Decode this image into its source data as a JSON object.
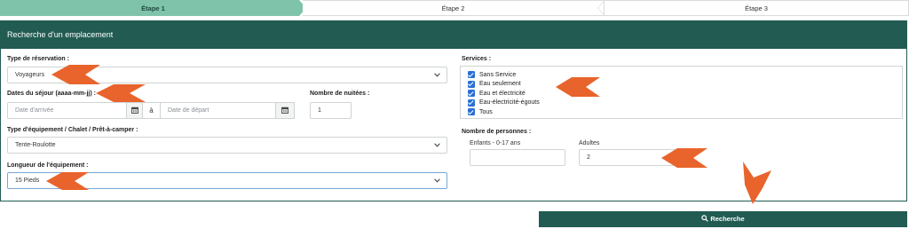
{
  "steps": [
    "Étape 1",
    "Étape 2",
    "Étape 3"
  ],
  "panel": {
    "title": "Recherche d'un emplacement"
  },
  "form": {
    "reservation_type": {
      "label": "Type de réservation :",
      "value": "Voyageurs"
    },
    "dates": {
      "label": "Dates du séjour (aaaa-mm-jj) :",
      "arrival_placeholder": "Date d'arrivée",
      "separator": "à",
      "departure_placeholder": "Date de départ"
    },
    "nights": {
      "label": "Nombre de nuitées :",
      "value": "1"
    },
    "equipment": {
      "label": "Type d'équipement / Chalet / Prêt-à-camper :",
      "value": "Tente-Roulotte"
    },
    "length": {
      "label": "Longueur de l'équipement :",
      "value": "15 Pieds"
    },
    "services": {
      "label": "Services :",
      "items": [
        {
          "label": "Sans Service",
          "checked": true
        },
        {
          "label": "Eau seulement",
          "checked": true
        },
        {
          "label": "Eau et électricité",
          "checked": true
        },
        {
          "label": "Eau-électricité-égouts",
          "checked": true
        },
        {
          "label": "Tous",
          "checked": true
        }
      ]
    },
    "persons": {
      "label": "Nombre de personnes :",
      "children_label": "Enfants - 0-17 ans",
      "children_value": "",
      "adults_label": "Adultes",
      "adults_value": "2"
    },
    "search_button": "Recherche"
  },
  "colors": {
    "primary": "#215b52",
    "step_active": "#7fc3aa",
    "annotation_arrow": "#e8642c",
    "checkbox": "#2a6fd6"
  }
}
